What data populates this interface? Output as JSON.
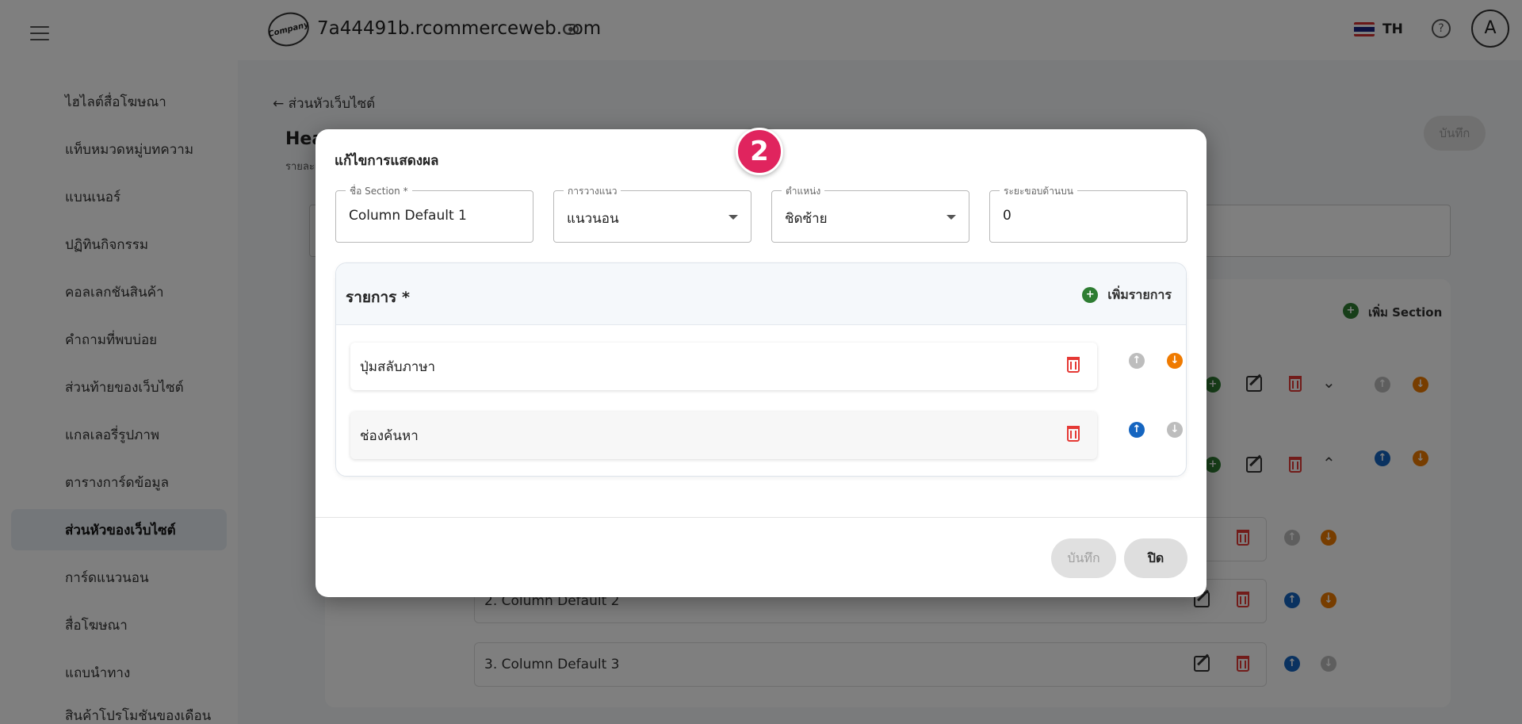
{
  "header": {
    "site_url": "7a44491b.rcommerceweb.com",
    "language": "TH",
    "avatar_letter": "A",
    "logo_text": "Company"
  },
  "sidebar": {
    "items": [
      {
        "label": "ไฮไลต์สื่อโฆษณา"
      },
      {
        "label": "แท็บหมวดหมู่บทความ"
      },
      {
        "label": "แบนเนอร์"
      },
      {
        "label": "ปฏิทินกิจกรรม"
      },
      {
        "label": "คอลเลกชันสินค้า"
      },
      {
        "label": "คำถามที่พบบ่อย"
      },
      {
        "label": "ส่วนท้ายของเว็บไซต์"
      },
      {
        "label": "แกลเลอรี่รูปภาพ"
      },
      {
        "label": "ตารางการ์ดข้อมูล"
      },
      {
        "label": "ส่วนหัวของเว็บไซต์",
        "active": true
      },
      {
        "label": "การ์ดแนวนอน"
      },
      {
        "label": "สื่อโฆษณา"
      },
      {
        "label": "แถบนำทาง"
      },
      {
        "label": "สินค้าโปรโมชันของเดือน"
      }
    ]
  },
  "page": {
    "back_label": "ส่วนหัวเว็บไซต์",
    "title": "Hea",
    "subtitle": "รายละเ",
    "save_label": "บันทึก",
    "add_section_label": "เพิ่ม Section",
    "rows": [
      "2. Column Default 2",
      "3. Column Default 3"
    ]
  },
  "dialog": {
    "title": "แก้ไขการแสดงผล",
    "step_number": "2",
    "fields": {
      "section_name": {
        "label": "ชื่อ Section *",
        "value": "Column Default 1"
      },
      "layout": {
        "label": "การวางแนว",
        "value": "แนวนอน"
      },
      "position": {
        "label": "ตำแหน่ง",
        "value": "ชิดซ้าย"
      },
      "top_margin": {
        "label": "ระยะขอบด้านบน",
        "value": "0"
      }
    },
    "list": {
      "title": "รายการ *",
      "add_label": "เพิ่มรายการ",
      "items": [
        {
          "label": "ปุ่มสลับภาษา"
        },
        {
          "label": "ช่องค้นหา"
        }
      ]
    },
    "save_label": "บันทึก",
    "close_label": "ปิด"
  },
  "colors": {
    "accent_badge": "#e0245e",
    "green": "#2e7d32",
    "blue": "#1565c0",
    "orange": "#ef7a00",
    "danger": "#e53935"
  }
}
